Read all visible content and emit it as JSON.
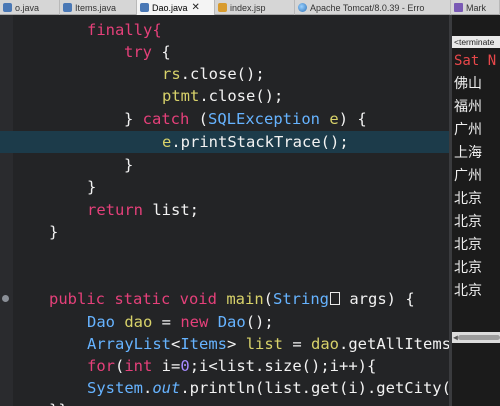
{
  "tabs": [
    {
      "label": "o.java",
      "icon": "java-file-icon"
    },
    {
      "label": "Items.java",
      "icon": "java-file-icon"
    },
    {
      "label": "Dao.java",
      "icon": "java-file-icon",
      "active": true,
      "close": "✕"
    },
    {
      "label": "index.jsp",
      "icon": "jsp-file-icon"
    },
    {
      "label": "Apache Tomcat/8.0.39 - Erro",
      "icon": "browser-icon"
    },
    {
      "label": "Mark",
      "icon": "markdown-icon"
    }
  ],
  "code": {
    "l1": "finally{",
    "l2_kw": "try",
    "l2_rest": " {",
    "l3_var": "rs",
    "l3_rest": ".close();",
    "l4_var": "ptmt",
    "l4_rest": ".close();",
    "l5_a": "} ",
    "l5_kw": "catch",
    "l5_b": " (",
    "l5_type": "SQLException",
    "l5_c": " ",
    "l5_var": "e",
    "l5_d": ") {",
    "l6_var": "e",
    "l6_rest": ".printStackTrace();",
    "l7": "}",
    "l8": "}",
    "l9_kw": "return",
    "l9_rest": " list;",
    "l10": "}",
    "l11_kw": "public static void",
    "l11_fn": "main",
    "l11_a": "(",
    "l11_type": "String",
    "l11_b": " args) {",
    "l12_type": "Dao",
    "l12_var": "dao",
    "l12_a": " = ",
    "l12_kw": "new",
    "l12_type2": "Dao",
    "l12_b": "();",
    "l13_type": "ArrayList",
    "l13_a": "<",
    "l13_type2": "Items",
    "l13_b": "> ",
    "l13_var": "list",
    "l13_c": " = ",
    "l13_var2": "dao",
    "l13_d": ".getAllItems();",
    "l14_kw": "for",
    "l14_a": "(",
    "l14_kw2": "int",
    "l14_b": " i=",
    "l14_num": "0",
    "l14_c": ";i<list.size();i++){",
    "l15_type": "System",
    "l15_a": ".",
    "l15_out": "out",
    "l15_b": ".println(list.get(i).getCity());",
    "l16": "}}"
  },
  "console": {
    "header": "<terminate",
    "date": "Sat N",
    "cities": [
      "佛山",
      "福州",
      "广州",
      "上海",
      "广州",
      "北京",
      "北京",
      "北京",
      "北京",
      "北京"
    ]
  },
  "colors": {
    "keyword": "#e5407a",
    "type": "#66b3ff",
    "variable": "#d8d26a",
    "number": "#a78bff",
    "editor_bg": "#232426",
    "highlight_line": "#1c3b4a"
  }
}
